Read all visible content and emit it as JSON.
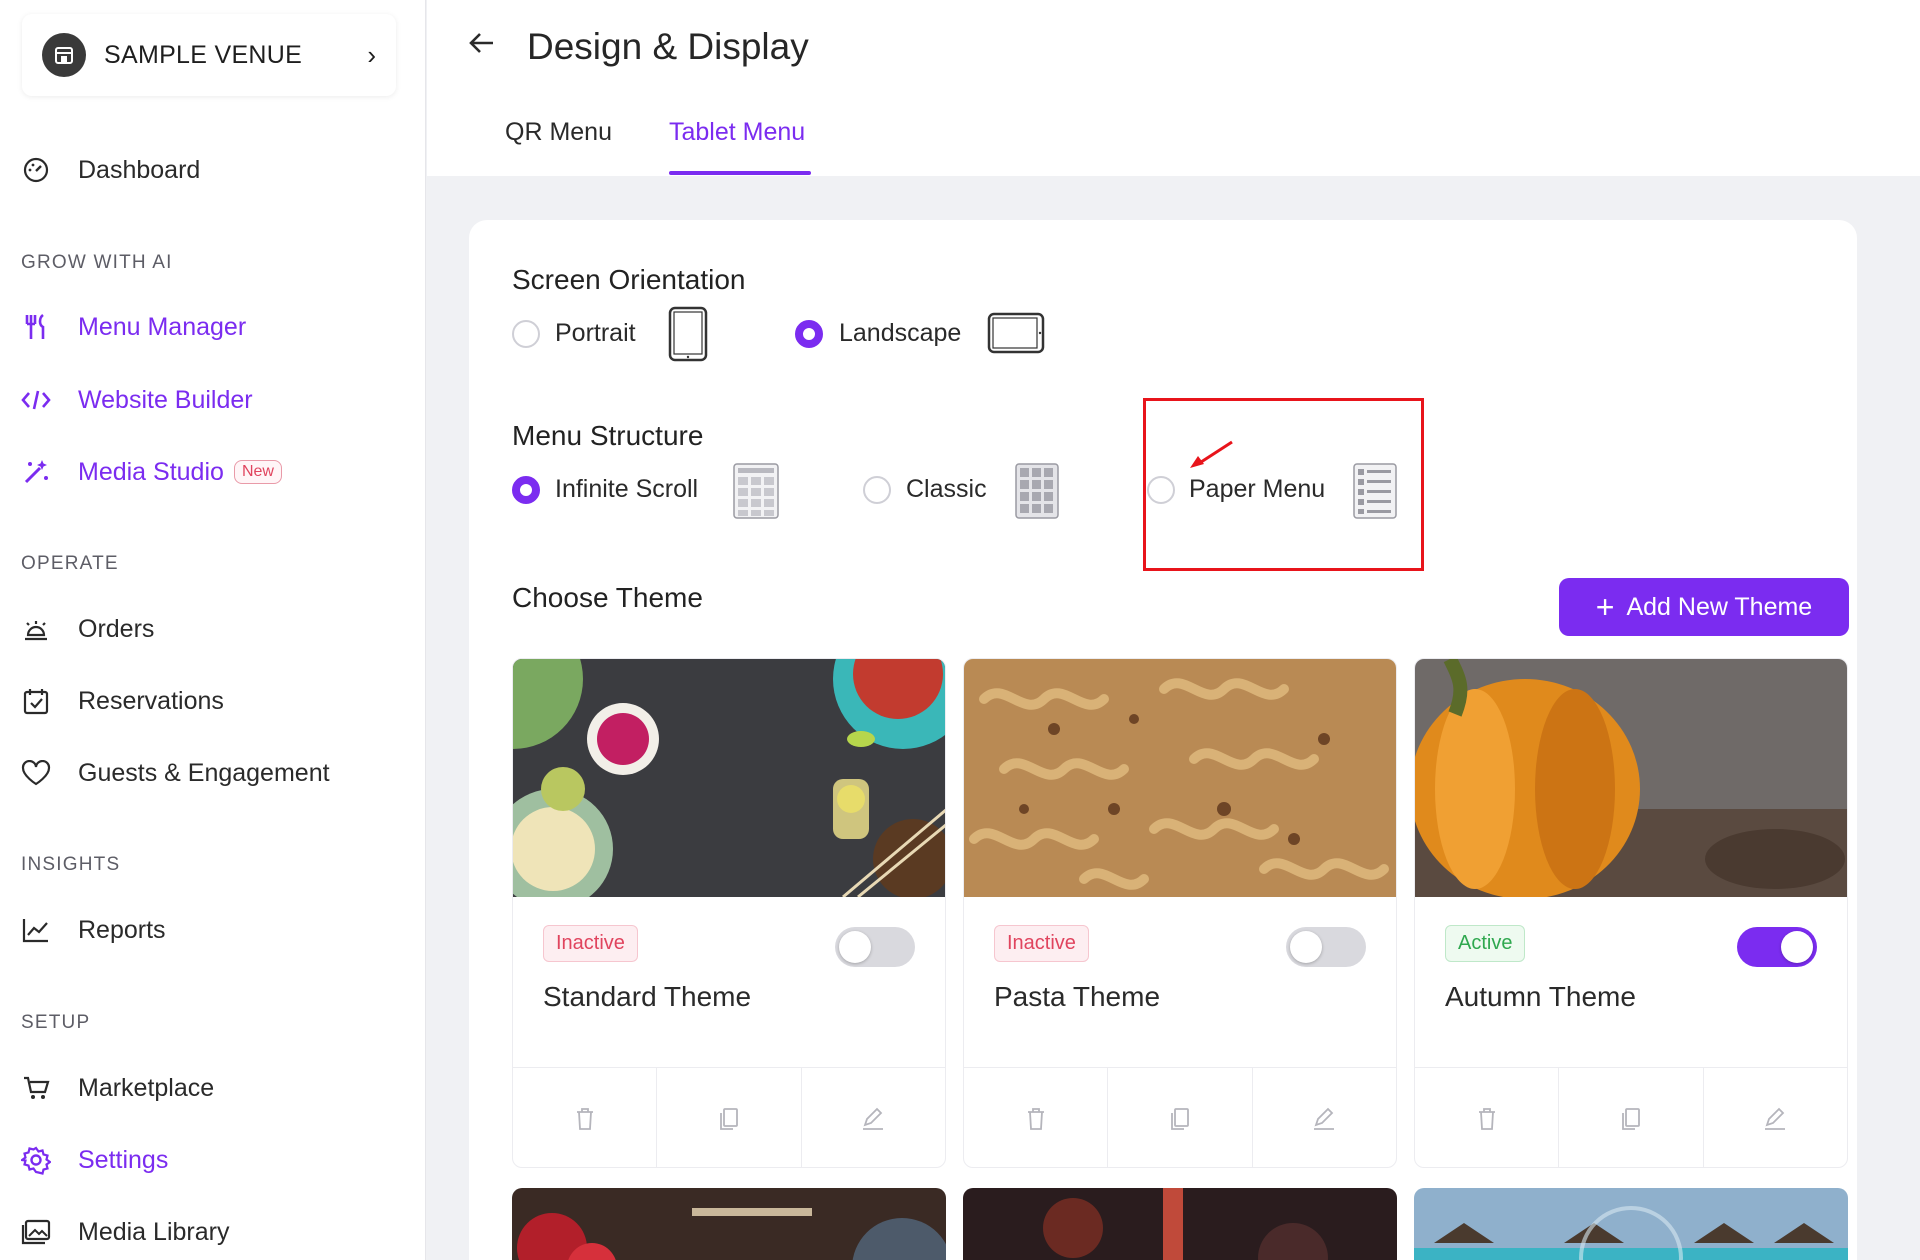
{
  "venue": {
    "name": "SAMPLE VENUE"
  },
  "nav": {
    "dashboard": "Dashboard",
    "sections": {
      "grow": "GROW WITH AI",
      "operate": "OPERATE",
      "insights": "INSIGHTS",
      "setup": "SETUP"
    },
    "menu_manager": "Menu Manager",
    "website_builder": "Website Builder",
    "media_studio": "Media Studio",
    "media_studio_badge": "New",
    "orders": "Orders",
    "reservations": "Reservations",
    "guests": "Guests & Engagement",
    "reports": "Reports",
    "marketplace": "Marketplace",
    "settings": "Settings",
    "media_library": "Media Library"
  },
  "header": {
    "title": "Design & Display",
    "tabs": [
      {
        "label": "QR Menu"
      },
      {
        "label": "Tablet Menu",
        "active": true
      }
    ]
  },
  "orientation": {
    "heading": "Screen Orientation",
    "options": [
      {
        "label": "Portrait",
        "selected": false
      },
      {
        "label": "Landscape",
        "selected": true
      }
    ]
  },
  "structure": {
    "heading": "Menu Structure",
    "options": [
      {
        "label": "Infinite Scroll",
        "selected": true
      },
      {
        "label": "Classic",
        "selected": false
      },
      {
        "label": "Paper Menu",
        "selected": false
      }
    ]
  },
  "themes": {
    "heading": "Choose Theme",
    "add_button": "Add New Theme",
    "items": [
      {
        "name": "Standard Theme",
        "status": "Inactive",
        "enabled": false
      },
      {
        "name": "Pasta Theme",
        "status": "Inactive",
        "enabled": false
      },
      {
        "name": "Autumn Theme",
        "status": "Active",
        "enabled": true
      }
    ]
  },
  "colors": {
    "accent": "#7b2cf0",
    "inactive": "#e0445e",
    "active": "#2fa84f",
    "annotation": "#e8141b"
  }
}
